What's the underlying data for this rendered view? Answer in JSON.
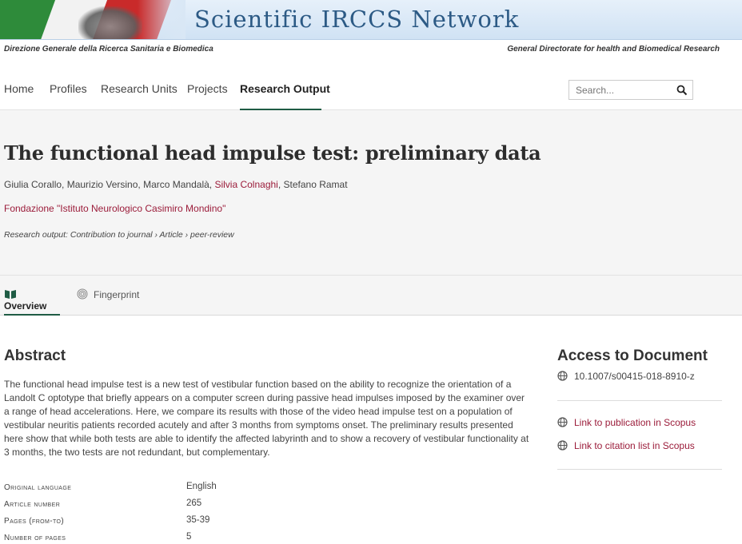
{
  "banner": {
    "title": "Scientific IRCCS Network",
    "subtitle_left": "Direzione Generale della Ricerca Sanitaria e Biomedica",
    "subtitle_right": "General Directorate for health and Biomedical Research"
  },
  "nav": {
    "items": [
      "Home",
      "Profiles",
      "Research Units",
      "Projects",
      "Research Output"
    ],
    "active": "Research Output",
    "search_placeholder": "Search..."
  },
  "article": {
    "title": "The functional head impulse test: preliminary data",
    "authors": {
      "a1": "Giulia Corallo, ",
      "a2": "Maurizio Versino, ",
      "a3": "Marco Mandalà, ",
      "a4_link": "Silvia Colnaghi",
      "a5": ", Stefano Ramat"
    },
    "organization": "Fondazione \"Istituto Neurologico Casimiro Mondino\"",
    "output_type": "Research output: Contribution to journal › Article › peer-review"
  },
  "tabs": {
    "overview": "Overview",
    "fingerprint": "Fingerprint"
  },
  "abstract": {
    "heading": "Abstract",
    "text": "The functional head impulse test is a new test of vestibular function based on the ability to recognize the orientation of a Landolt C optotype that briefly appears on a computer screen during passive head impulses imposed by the examiner over a range of head accelerations. Here, we compare its results with those of the video head impulse test on a population of vestibular neuritis patients recorded acutely and after 3 months from symptoms onset. The preliminary results presented here show that while both tests are able to identify the affected labyrinth and to show a recovery of vestibular functionality at 3 months, the two tests are not redundant, but complementary."
  },
  "metadata": [
    {
      "key": "Original language",
      "value": "English"
    },
    {
      "key": "Article number",
      "value": "265"
    },
    {
      "key": "Pages (from-to)",
      "value": "35-39"
    },
    {
      "key": "Number of pages",
      "value": "5"
    }
  ],
  "sidebar": {
    "heading": "Access to Document",
    "doi": "10.1007/s00415-018-8910-z",
    "link_publication": "Link to publication in Scopus",
    "link_citations": "Link to citation list in Scopus"
  },
  "colors": {
    "accent_green": "#1f5c44",
    "link_red": "#9b1c3a",
    "banner_blue": "#2c5a85"
  },
  "icons": {
    "search": "search-icon",
    "overview": "book-icon",
    "fingerprint": "fingerprint-icon",
    "globe": "globe-icon"
  }
}
